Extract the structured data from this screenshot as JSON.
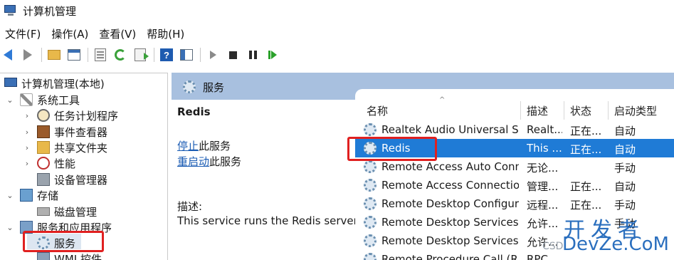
{
  "window": {
    "title": "计算机管理"
  },
  "menu": [
    "文件(F)",
    "操作(A)",
    "查看(V)",
    "帮助(H)"
  ],
  "toolbar": {
    "icons": [
      "back-icon",
      "forward-icon",
      "up-folder-icon",
      "show-hide-tree-icon",
      "properties-icon",
      "refresh-icon",
      "export-list-icon",
      "help-icon",
      "action-pane-icon",
      "start-service-icon",
      "stop-service-icon",
      "pause-service-icon",
      "restart-service-icon"
    ]
  },
  "tree": {
    "root": "计算机管理(本地)",
    "system_tools": "系统工具",
    "task_scheduler": "任务计划程序",
    "event_viewer": "事件查看器",
    "shared_folders": "共享文件夹",
    "performance": "性能",
    "device_manager": "设备管理器",
    "storage": "存储",
    "disk_management": "磁盘管理",
    "services_apps": "服务和应用程序",
    "services": "服务",
    "wmi": "WMI 控件"
  },
  "header": {
    "title": "服务"
  },
  "description": {
    "service_name": "Redis",
    "stop_link": "停止",
    "stop_suffix": "此服务",
    "restart_link": "重启动",
    "restart_suffix": "此服务",
    "desc_label": "描述:",
    "desc_text": "This service runs the Redis server"
  },
  "columns": {
    "name": "名称",
    "desc": "描述",
    "status": "状态",
    "startup": "启动类型"
  },
  "rows": [
    {
      "name": "Realtek Audio Universal Se...",
      "desc": "Realt...",
      "status": "正在...",
      "startup": "自动"
    },
    {
      "name": "Redis",
      "desc": "This ...",
      "status": "正在...",
      "startup": "自动"
    },
    {
      "name": "Remote Access Auto Conn...",
      "desc": "无论...",
      "status": "",
      "startup": "手动"
    },
    {
      "name": "Remote Access Connectio...",
      "desc": "管理...",
      "status": "正在...",
      "startup": "自动"
    },
    {
      "name": "Remote Desktop Configur...",
      "desc": "远程...",
      "status": "正在...",
      "startup": "手动"
    },
    {
      "name": "Remote Desktop Services",
      "desc": "允许...",
      "status": "",
      "startup": "手动"
    },
    {
      "name": "Remote Desktop Services ...",
      "desc": "允许...",
      "status": "",
      "startup": ""
    },
    {
      "name": "Remote Procedure Call (R...",
      "desc": "RPC...",
      "status": "",
      "startup": ""
    }
  ],
  "watermark": {
    "top": "开发者",
    "csdn": "CSD",
    "bottom": "DevZe.CoM"
  }
}
